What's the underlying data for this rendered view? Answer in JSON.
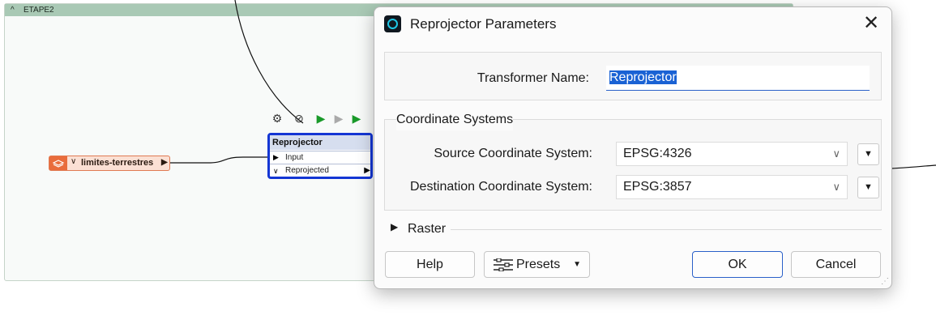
{
  "workspace": {
    "bookmark_title": "ETAPE2",
    "feature_type": {
      "name": "limites-terrestres"
    },
    "transformer_node": {
      "name": "Reprojector",
      "input_port": "Input",
      "output_port": "Reprojected"
    }
  },
  "dialog": {
    "title": "Reprojector Parameters",
    "close_icon": "close-icon",
    "transformer_name_label": "Transformer Name:",
    "transformer_name_value": "Reprojector",
    "coordinate_systems_title": "Coordinate Systems",
    "source_label": "Source Coordinate System:",
    "source_value": "EPSG:4326",
    "destination_label": "Destination Coordinate System:",
    "destination_value": "EPSG:3857",
    "raster_label": "Raster",
    "buttons": {
      "help": "Help",
      "presets": "Presets",
      "ok": "OK",
      "cancel": "Cancel"
    }
  },
  "colors": {
    "accent": "#2a60c9",
    "selection": "#1a62d4",
    "bookmark_header": "#a9c9b5",
    "node_border": "#1436d4",
    "feature_orange": "#e96c3c"
  }
}
